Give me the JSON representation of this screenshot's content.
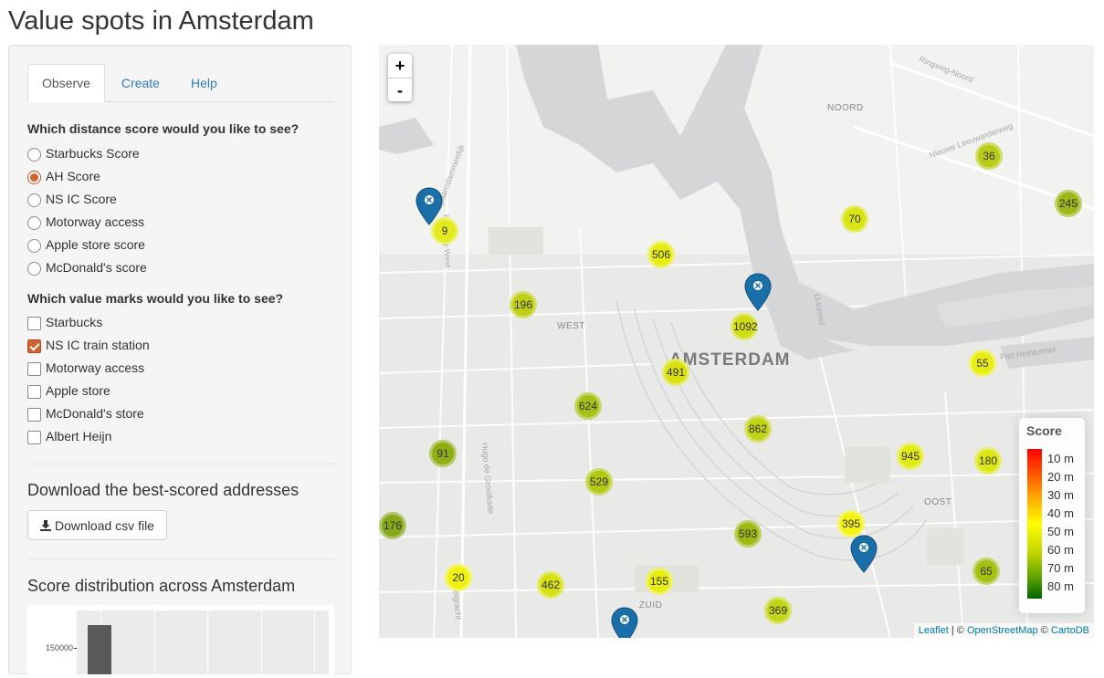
{
  "page": {
    "title": "Value spots in Amsterdam"
  },
  "tabs": [
    {
      "label": "Observe",
      "active": true
    },
    {
      "label": "Create",
      "active": false
    },
    {
      "label": "Help",
      "active": false
    }
  ],
  "distance_question": "Which distance score would you like to see?",
  "distance_options": [
    {
      "label": "Starbucks Score",
      "checked": false
    },
    {
      "label": "AH Score",
      "checked": true
    },
    {
      "label": "NS IC Score",
      "checked": false
    },
    {
      "label": "Motorway access",
      "checked": false
    },
    {
      "label": "Apple store score",
      "checked": false
    },
    {
      "label": "McDonald's score",
      "checked": false
    }
  ],
  "marks_question": "Which value marks would you like to see?",
  "mark_options": [
    {
      "label": "Starbucks",
      "checked": false
    },
    {
      "label": "NS IC train station",
      "checked": true
    },
    {
      "label": "Motorway access",
      "checked": false
    },
    {
      "label": "Apple store",
      "checked": false
    },
    {
      "label": "McDonald's store",
      "checked": false
    },
    {
      "label": "Albert Heijn",
      "checked": false
    }
  ],
  "download": {
    "heading": "Download the best-scored addresses",
    "button_label": "Download csv file",
    "icon": "download-icon"
  },
  "distribution": {
    "heading": "Score distribution across Amsterdam",
    "y_tick": "150000"
  },
  "map": {
    "zoom_in": "+",
    "zoom_out": "-",
    "labels": {
      "city": "AMSTERDAM",
      "noord": "NOORD",
      "west": "WEST",
      "oost": "OOST",
      "zuid": "ZUID"
    },
    "streets": [
      "Singelgracht",
      "Ringweg-Noord",
      "Nieuwe Leeuwarderweg",
      "Ringweg-West",
      "Piet Heintunnel",
      "IJ-tunnel",
      "Spaarndammerdijk",
      "Hugo de Grootkade"
    ],
    "clusters": [
      9,
      506,
      196,
      1092,
      491,
      624,
      862,
      91,
      529,
      176,
      593,
      20,
      462,
      155,
      369,
      395,
      945,
      180,
      65,
      55,
      70,
      36,
      245
    ],
    "legend": {
      "title": "Score",
      "items": [
        "10 m",
        "20 m",
        "30 m",
        "40 m",
        "50 m",
        "60 m",
        "70 m",
        "80 m"
      ]
    },
    "attribution": {
      "leaflet": "Leaflet",
      "osm": "OpenStreetMap",
      "carto": "CartoDB",
      "sep1": " | © ",
      "sep2": " © "
    }
  },
  "colors": {
    "accent": "#d2622e",
    "link": "#337ab7",
    "marker": "#1a6fa8"
  }
}
